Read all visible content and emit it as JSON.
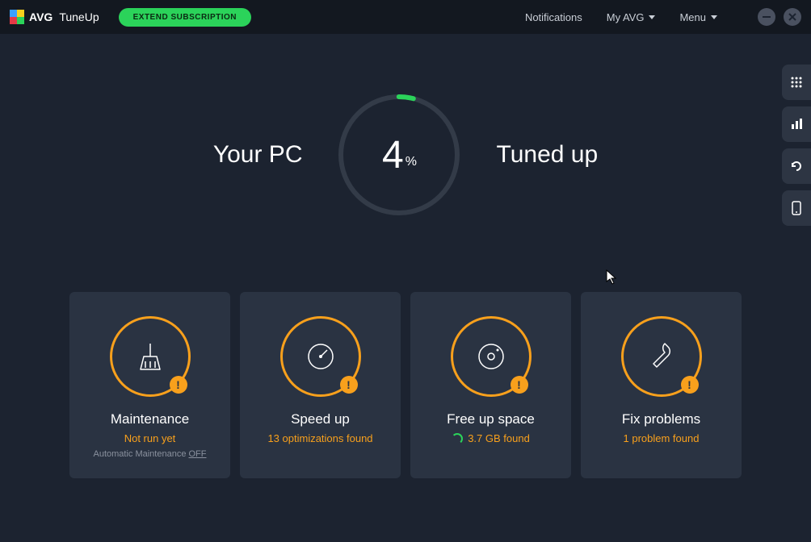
{
  "titlebar": {
    "brand": "AVG",
    "product": "TuneUp",
    "extend_label": "EXTEND SUBSCRIPTION",
    "nav": {
      "notifications": "Notifications",
      "myavg": "My AVG",
      "menu": "Menu"
    }
  },
  "hero": {
    "left": "Your PC",
    "right": "Tuned up",
    "percent_value": "4",
    "percent_symbol": "%"
  },
  "cards": [
    {
      "title": "Maintenance",
      "sub": "Not run yet",
      "extra_prefix": "Automatic Maintenance ",
      "extra_toggle": "OFF"
    },
    {
      "title": "Speed up",
      "sub": "13 optimizations found"
    },
    {
      "title": "Free up space",
      "sub": "3.7 GB found"
    },
    {
      "title": "Fix problems",
      "sub": "1 problem found"
    }
  ]
}
